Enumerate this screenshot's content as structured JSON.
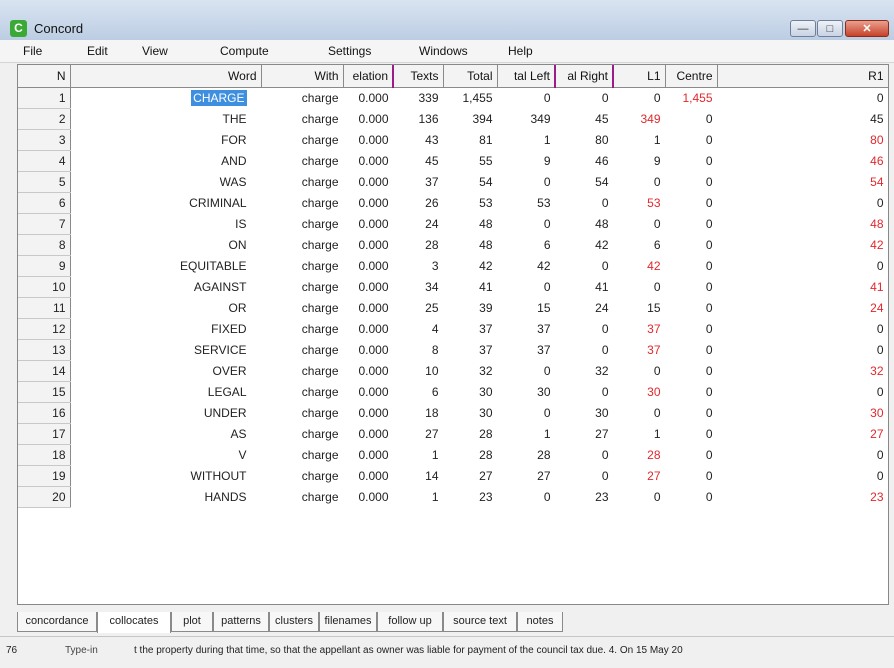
{
  "window": {
    "title": "Concord",
    "icon": "concord-app-icon",
    "controls": [
      "minimize-icon",
      "maximize-icon",
      "close-icon"
    ]
  },
  "menu": [
    "File",
    "Edit",
    "View",
    "Compute",
    "Settings",
    "Windows",
    "Help"
  ],
  "table": {
    "columns": [
      "N",
      "Word",
      "With",
      "elation",
      "Texts",
      "Total",
      "tal Left",
      "al Right",
      "L1",
      "Centre",
      "R1"
    ],
    "rows": [
      {
        "n": "1",
        "word": "CHARGE",
        "with": "charge",
        "relation": "0.000",
        "texts": "339",
        "total": "1,455",
        "left": "0",
        "right": "0",
        "l1": "0",
        "centre": "1,455",
        "r1": "0",
        "red": "centre",
        "selected": true
      },
      {
        "n": "2",
        "word": "THE",
        "with": "charge",
        "relation": "0.000",
        "texts": "136",
        "total": "394",
        "left": "349",
        "right": "45",
        "l1": "349",
        "centre": "0",
        "r1": "45",
        "red": "l1"
      },
      {
        "n": "3",
        "word": "FOR",
        "with": "charge",
        "relation": "0.000",
        "texts": "43",
        "total": "81",
        "left": "1",
        "right": "80",
        "l1": "1",
        "centre": "0",
        "r1": "80",
        "red": "r1"
      },
      {
        "n": "4",
        "word": "AND",
        "with": "charge",
        "relation": "0.000",
        "texts": "45",
        "total": "55",
        "left": "9",
        "right": "46",
        "l1": "9",
        "centre": "0",
        "r1": "46",
        "red": "r1"
      },
      {
        "n": "5",
        "word": "WAS",
        "with": "charge",
        "relation": "0.000",
        "texts": "37",
        "total": "54",
        "left": "0",
        "right": "54",
        "l1": "0",
        "centre": "0",
        "r1": "54",
        "red": "r1"
      },
      {
        "n": "6",
        "word": "CRIMINAL",
        "with": "charge",
        "relation": "0.000",
        "texts": "26",
        "total": "53",
        "left": "53",
        "right": "0",
        "l1": "53",
        "centre": "0",
        "r1": "0",
        "red": "l1"
      },
      {
        "n": "7",
        "word": "IS",
        "with": "charge",
        "relation": "0.000",
        "texts": "24",
        "total": "48",
        "left": "0",
        "right": "48",
        "l1": "0",
        "centre": "0",
        "r1": "48",
        "red": "r1"
      },
      {
        "n": "8",
        "word": "ON",
        "with": "charge",
        "relation": "0.000",
        "texts": "28",
        "total": "48",
        "left": "6",
        "right": "42",
        "l1": "6",
        "centre": "0",
        "r1": "42",
        "red": "r1"
      },
      {
        "n": "9",
        "word": "EQUITABLE",
        "with": "charge",
        "relation": "0.000",
        "texts": "3",
        "total": "42",
        "left": "42",
        "right": "0",
        "l1": "42",
        "centre": "0",
        "r1": "0",
        "red": "l1"
      },
      {
        "n": "10",
        "word": "AGAINST",
        "with": "charge",
        "relation": "0.000",
        "texts": "34",
        "total": "41",
        "left": "0",
        "right": "41",
        "l1": "0",
        "centre": "0",
        "r1": "41",
        "red": "r1"
      },
      {
        "n": "11",
        "word": "OR",
        "with": "charge",
        "relation": "0.000",
        "texts": "25",
        "total": "39",
        "left": "15",
        "right": "24",
        "l1": "15",
        "centre": "0",
        "r1": "24",
        "red": "r1"
      },
      {
        "n": "12",
        "word": "FIXED",
        "with": "charge",
        "relation": "0.000",
        "texts": "4",
        "total": "37",
        "left": "37",
        "right": "0",
        "l1": "37",
        "centre": "0",
        "r1": "0",
        "red": "l1"
      },
      {
        "n": "13",
        "word": "SERVICE",
        "with": "charge",
        "relation": "0.000",
        "texts": "8",
        "total": "37",
        "left": "37",
        "right": "0",
        "l1": "37",
        "centre": "0",
        "r1": "0",
        "red": "l1"
      },
      {
        "n": "14",
        "word": "OVER",
        "with": "charge",
        "relation": "0.000",
        "texts": "10",
        "total": "32",
        "left": "0",
        "right": "32",
        "l1": "0",
        "centre": "0",
        "r1": "32",
        "red": "r1"
      },
      {
        "n": "15",
        "word": "LEGAL",
        "with": "charge",
        "relation": "0.000",
        "texts": "6",
        "total": "30",
        "left": "30",
        "right": "0",
        "l1": "30",
        "centre": "0",
        "r1": "0",
        "red": "l1"
      },
      {
        "n": "16",
        "word": "UNDER",
        "with": "charge",
        "relation": "0.000",
        "texts": "18",
        "total": "30",
        "left": "0",
        "right": "30",
        "l1": "0",
        "centre": "0",
        "r1": "30",
        "red": "r1"
      },
      {
        "n": "17",
        "word": "AS",
        "with": "charge",
        "relation": "0.000",
        "texts": "27",
        "total": "28",
        "left": "1",
        "right": "27",
        "l1": "1",
        "centre": "0",
        "r1": "27",
        "red": "r1"
      },
      {
        "n": "18",
        "word": "V",
        "with": "charge",
        "relation": "0.000",
        "texts": "1",
        "total": "28",
        "left": "28",
        "right": "0",
        "l1": "28",
        "centre": "0",
        "r1": "0",
        "red": "l1"
      },
      {
        "n": "19",
        "word": "WITHOUT",
        "with": "charge",
        "relation": "0.000",
        "texts": "14",
        "total": "27",
        "left": "27",
        "right": "0",
        "l1": "27",
        "centre": "0",
        "r1": "0",
        "red": "l1"
      },
      {
        "n": "20",
        "word": "HANDS",
        "with": "charge",
        "relation": "0.000",
        "texts": "1",
        "total": "23",
        "left": "0",
        "right": "23",
        "l1": "0",
        "centre": "0",
        "r1": "23",
        "red": "r1"
      }
    ]
  },
  "tabs": [
    "concordance",
    "collocates",
    "plot",
    "patterns",
    "clusters",
    "filenames",
    "follow up",
    "source text",
    "notes"
  ],
  "active_tab": "collocates",
  "status": {
    "count": "76",
    "mode": "Type-in",
    "context": "t the property during that time, so that the appellant as owner was liable for payment of the council tax due. 4. On 15 May 20"
  },
  "colors": {
    "highlight_red": "#e0282d",
    "selection_blue": "#3f8fe0",
    "column_accent": "#9c1b8a"
  }
}
